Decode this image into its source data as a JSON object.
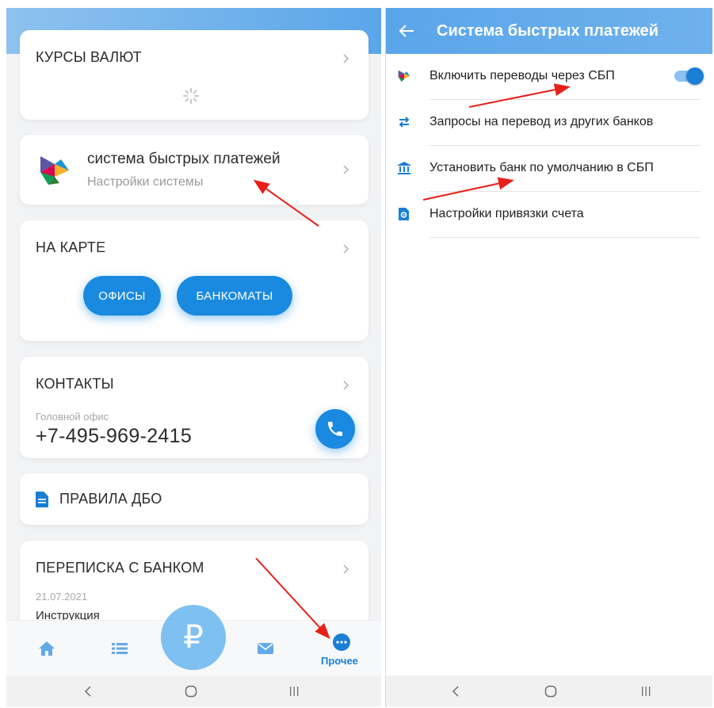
{
  "left_screen": {
    "rates_card": {
      "title": "КУРСЫ ВАЛЮТ"
    },
    "sbp_card": {
      "title": "система быстрых платежей",
      "subtitle": "Настройки системы"
    },
    "map_card": {
      "title": "НА КАРТЕ",
      "offices_label": "ОФИСЫ",
      "atms_label": "БАНКОМАТЫ"
    },
    "contacts_card": {
      "title": "КОНТАКТЫ",
      "office_label": "Головной офис",
      "phone": "+7-495-969-2415"
    },
    "rules_card": {
      "title": "ПРАВИЛА ДБО"
    },
    "chat_card": {
      "title": "ПЕРЕПИСКА С БАНКОМ",
      "date": "21.07.2021",
      "message": "Инструкция"
    },
    "bottom_nav": {
      "ruble_symbol": "₽",
      "more_label": "Прочее"
    }
  },
  "right_screen": {
    "header": {
      "title": "Система быстрых платежей"
    },
    "rows": [
      {
        "label": "Включить переводы через СБП",
        "toggle_on": true
      },
      {
        "label": "Запросы на перевод из других банков"
      },
      {
        "label": "Установить банк по умолчанию в СБП"
      },
      {
        "label": "Настройки привязки счета"
      }
    ]
  },
  "colors": {
    "accent": "#1a8ae0",
    "header_blue": "#5aa6ea",
    "annotation_arrow": "#e8201a"
  }
}
